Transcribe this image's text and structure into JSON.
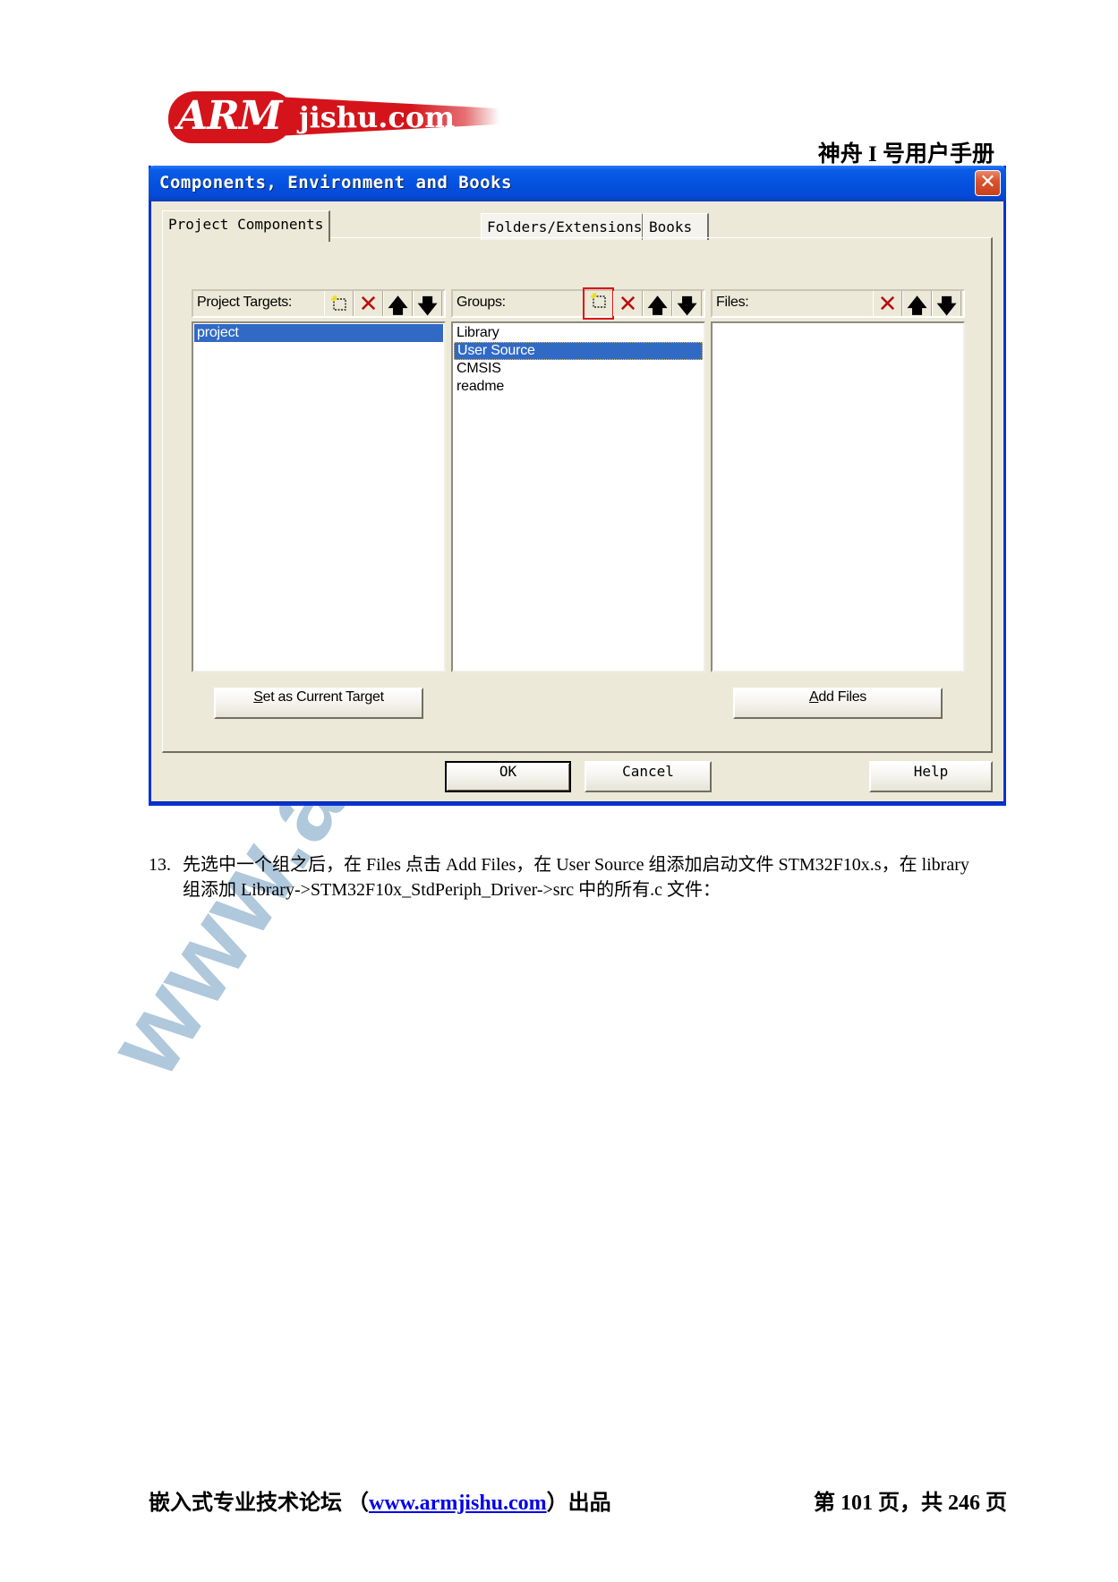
{
  "header": {
    "logo": {
      "brand": "ARM",
      "site": "jishu.com",
      "brand_color": "#d4141a"
    },
    "manual_title": "神舟 I 号用户手册"
  },
  "dialog": {
    "title": "Components, Environment and Books",
    "close_icon": "close-icon",
    "tabs": [
      {
        "label": "Project Components",
        "active": true
      },
      {
        "label": "Folders/Extensions",
        "active": false
      },
      {
        "label": "Books",
        "active": false
      }
    ],
    "panels": {
      "targets": {
        "label": "Project Targets:",
        "tools": [
          "new-icon",
          "delete-icon",
          "move-up-icon",
          "move-down-icon"
        ],
        "items": [
          {
            "text": "project",
            "selected": true
          }
        ]
      },
      "groups": {
        "label": "Groups:",
        "tools": [
          "new-icon",
          "delete-icon",
          "move-up-icon",
          "move-down-icon"
        ],
        "highlighted_tool": "new-icon",
        "items": [
          {
            "text": "Library",
            "selected": false
          },
          {
            "text": "User Source",
            "selected": true
          },
          {
            "text": "CMSIS",
            "selected": false
          },
          {
            "text": "readme",
            "selected": false
          }
        ]
      },
      "files": {
        "label": "Files:",
        "tools": [
          "delete-icon",
          "move-up-icon",
          "move-down-icon"
        ],
        "items": []
      }
    },
    "buttons": {
      "set_target": {
        "mnemonic": "S",
        "rest": "et as Current Target"
      },
      "add_files": {
        "mnemonic": "A",
        "rest": "dd Files"
      },
      "ok": "OK",
      "cancel": "Cancel",
      "help": "Help"
    },
    "colors": {
      "titlebar": "#0452e0",
      "selection": "#316ac5",
      "face": "#ece9d8",
      "highlight_box": "#e01010"
    }
  },
  "body": {
    "step_number": "13.",
    "line1": "先选中一个组之后，在 Files 点击 Add Files，在 User Source 组添加启动文件 STM32F10x.s，在 library",
    "line2": "组添加 Library->STM32F10x_StdPeriph_Driver->src 中的所有.c 文件："
  },
  "watermark": "www.armjishu.com",
  "footer": {
    "left_prefix": "嵌入式专业技术论坛  （",
    "link": "www.armjishu.com",
    "left_suffix": "）出品",
    "page_info": "第 101 页，共 246 页"
  }
}
